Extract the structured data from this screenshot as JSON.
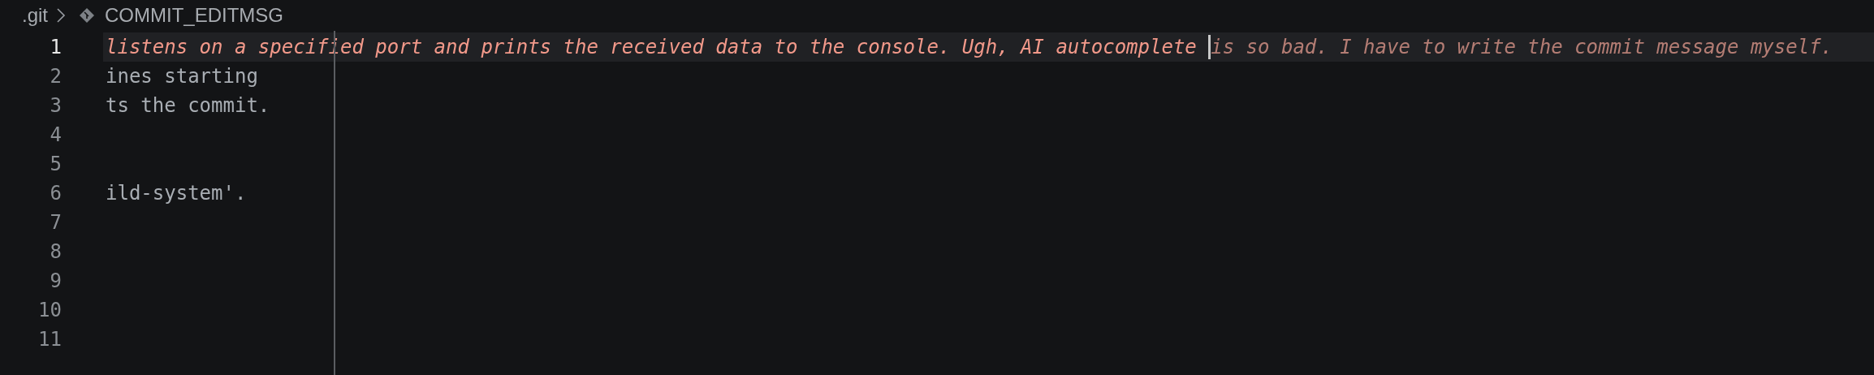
{
  "breadcrumb": [
    {
      "label": ".git",
      "kind": "folder"
    },
    {
      "label": "COMMIT_EDITMSG",
      "kind": "git-file"
    }
  ],
  "editor": {
    "lines": [
      {
        "number": "1",
        "current": true,
        "kind": "message",
        "text": "listens on a specified port and prints the received data to the console. Ugh, AI autocomplete ",
        "ghost": "is so bad. I have to write the commit message myself."
      },
      {
        "number": "2",
        "current": false,
        "kind": "comment",
        "text": "ines starting"
      },
      {
        "number": "3",
        "current": false,
        "kind": "comment",
        "text": "ts the commit."
      },
      {
        "number": "4",
        "current": false
      },
      {
        "number": "5",
        "current": false
      },
      {
        "number": "6",
        "current": false,
        "kind": "comment",
        "text": "ild-system'."
      },
      {
        "number": "7",
        "current": false
      },
      {
        "number": "8",
        "current": false
      },
      {
        "number": "9",
        "current": false
      },
      {
        "number": "10",
        "current": false
      },
      {
        "number": "11",
        "current": false
      }
    ]
  }
}
